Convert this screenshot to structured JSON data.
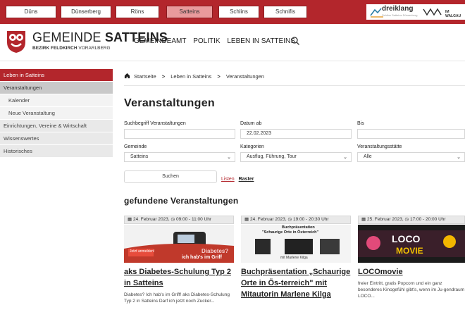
{
  "topbar": {
    "towns": [
      "Düns",
      "Dünserberg",
      "Röns",
      "Satteins",
      "Schlins",
      "Schnifis"
    ],
    "active_town": "Satteins",
    "dreiklang_logo": "dreiklang",
    "dreiklang_tag": "Schlins Satteins Dünserberg",
    "im_walgau_logo": "IM WALGAU"
  },
  "header": {
    "title_prefix": "GEMEINDE",
    "title_bold": "SATTEINS",
    "sub_bold": "BEZIRK FELDKIRCH",
    "sub_rest": "VORARLBERG",
    "nav": [
      "GEMEINDEAMT",
      "POLITIK",
      "LEBEN IN SATTEINS"
    ],
    "search_icon": "search-icon"
  },
  "sidebar": {
    "items": [
      {
        "label": "Leben in Satteins",
        "state": "active",
        "level": 0
      },
      {
        "label": "Veranstaltungen",
        "state": "selected",
        "level": 0
      },
      {
        "label": "Kalender",
        "state": "",
        "level": 1
      },
      {
        "label": "Neue Veranstaltung",
        "state": "",
        "level": 1
      },
      {
        "label": "Einrichtungen, Vereine & Wirtschaft",
        "state": "",
        "level": 0
      },
      {
        "label": "Wissenswertes",
        "state": "",
        "level": 0
      },
      {
        "label": "Historisches",
        "state": "",
        "level": 0
      }
    ]
  },
  "breadcrumb": {
    "items": [
      "Startseite",
      "Leben in Satteins",
      "Veranstaltungen"
    ],
    "separator": ">"
  },
  "main": {
    "title": "Veranstaltungen",
    "filters": {
      "search_label": "Suchbegriff Veranstaltungen",
      "search_value": "",
      "date_label": "Datum ab",
      "date_value": "22.02.2023",
      "to_label": "Bis",
      "to_value": "",
      "gemeinde_label": "Gemeinde",
      "gemeinde_value": "Satteins",
      "kategorien_label": "Kategorien",
      "kategorien_value": "Ausflug, Führung, Tour",
      "staette_label": "Veranstaltungsstätte",
      "staette_value": "Alle"
    },
    "search_button": "Suchen",
    "view_list": "Listen",
    "view_grid": "Raster",
    "results_title": "gefundene Veranstaltungen"
  },
  "cards": [
    {
      "date": "24. Februar 2023,",
      "time": "09:00 - 11:00 Uhr",
      "title": "aks Diabetes-Schulung Typ 2 in Satteins",
      "text": "Diabetes? Ich hab's im Griff! aks Diabetes-Schulung Typ 2 in Satteins Darf ich jetzt noch Zucker...",
      "img_line1": "Diabetes?",
      "img_line2": "ich hab's im Griff",
      "img_badge": "Jetzt anmelden!"
    },
    {
      "date": "24. Februar 2023,",
      "time": "19:00 - 20:30 Uhr",
      "title": "Buchpräsentation „Schaurige Orte in Ös-terreich\" mit Mitautorin Marlene Kilga",
      "text": "",
      "img_line1": "Buchpräsentation",
      "img_line2": "\"Schaurige Orte in Österreich\"",
      "img_line3": "mit Marlene Kilga"
    },
    {
      "date": "25. Februar 2023,",
      "time": "17:00 - 20:00 Uhr",
      "title": "LOCOmovie",
      "text": "freier Eintritt, gratis Popcorn und ein ganz besonderes Kinogefühl gibt's, wenn im Ju-gendraum LOCO...",
      "img_line1": "LOCO",
      "img_line2": "MOVIE"
    }
  ],
  "colors": {
    "brand_red": "#b3262c",
    "active_town_bg": "#e99a9c",
    "sidebar_bg": "#e9e9e9",
    "sidebar_selected": "#c9c9c9"
  }
}
